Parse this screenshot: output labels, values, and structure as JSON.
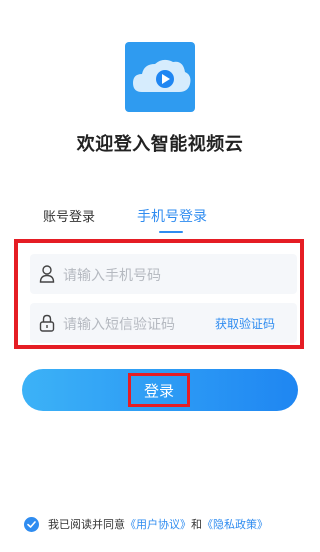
{
  "app_title": "欢迎登入智能视频云",
  "tabs": {
    "account": "账号登录",
    "phone": "手机号登录"
  },
  "form": {
    "phone_placeholder": "请输入手机号码",
    "code_placeholder": "请输入短信验证码",
    "get_code": "获取验证码"
  },
  "login_button": "登录",
  "agreement": {
    "prefix": "我已阅读并同意",
    "user_agreement": "《用户协议》",
    "and": "和",
    "privacy_policy": "《隐私政策》"
  },
  "colors": {
    "accent": "#2f8cf0",
    "highlight_frame": "#e51d24",
    "logo_bg": "#2f9bf0"
  }
}
